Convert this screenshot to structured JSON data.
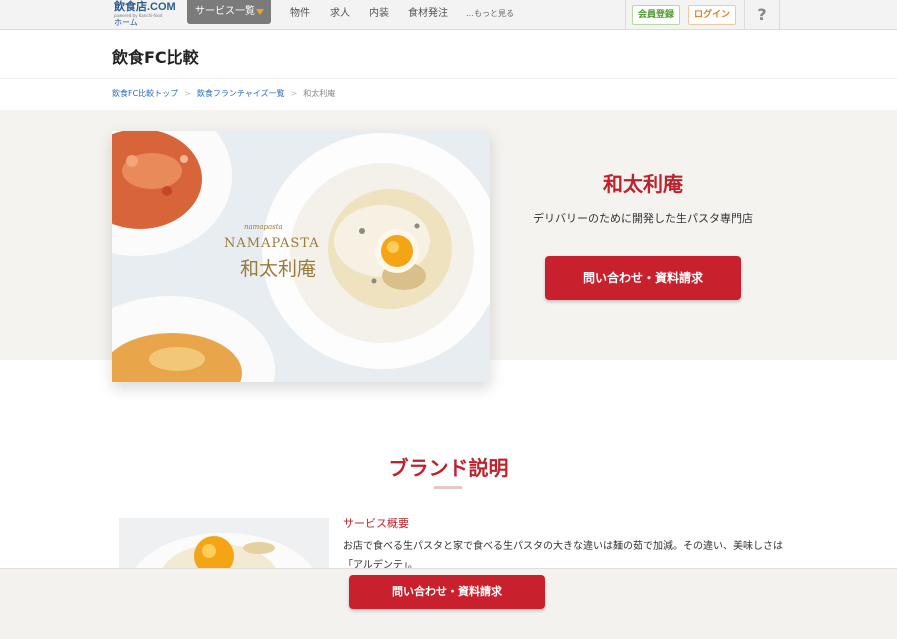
{
  "topnav": {
    "logo": {
      "main": "飲食店.COM",
      "sub": "powered by Kanchi-food",
      "home": "ホーム"
    },
    "service_menu": "サービス一覧",
    "links": [
      "物件",
      "求人",
      "内装",
      "食材発注",
      "…もっと見る"
    ],
    "member_button": "会員登録",
    "login_button": "ログイン",
    "help": "?"
  },
  "site": {
    "title": "飲食FC比較"
  },
  "breadcrumb": {
    "items": [
      "飲食FC比較トップ",
      "飲食フランチャイズ一覧",
      "和太利庵"
    ],
    "separator": ">"
  },
  "hero": {
    "name": "和太利庵",
    "description": "デリバリーのために開発した生パスタ専門店",
    "cta": "問い合わせ・資料請求",
    "image_overlay": {
      "small": "namapasta",
      "brand_en": "NAMAPASTA",
      "brand_jp": "和太利庵"
    }
  },
  "brand": {
    "title": "ブランド説明",
    "service_heading": "サービス概要",
    "service_text": "お店で食べる生パスタと家で食べる生パスタの大きな違いは麺の茹で加減。その違い、美味しさは「アルデンテ」。"
  },
  "bottom_bar": {
    "cta": "問い合わせ・資料請求"
  },
  "colors": {
    "accent": "#c8202c",
    "nav_bg": "#f3f3f3",
    "hero_bg": "#f5f3f0",
    "link": "#2a6fb5"
  }
}
